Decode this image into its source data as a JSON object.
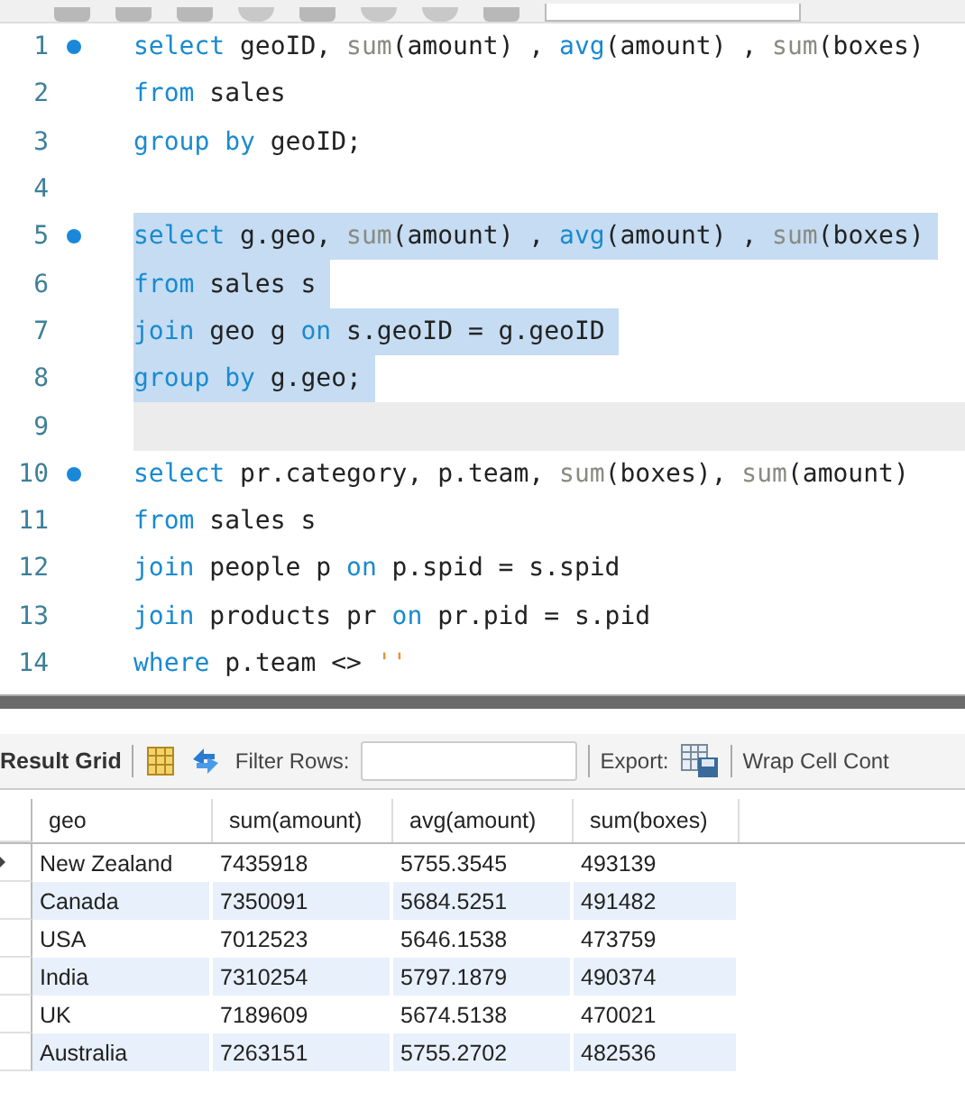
{
  "editor": {
    "lines": [
      {
        "number": "1",
        "statement_start": true,
        "selected": false,
        "current": false,
        "tokens": [
          {
            "kind": "keyword",
            "text": "select"
          },
          {
            "kind": "plain",
            "text": " geoID, "
          },
          {
            "kind": "function",
            "text": "sum"
          },
          {
            "kind": "plain",
            "text": "(amount) , "
          },
          {
            "kind": "keyword",
            "text": "avg"
          },
          {
            "kind": "plain",
            "text": "(amount) , "
          },
          {
            "kind": "function",
            "text": "sum"
          },
          {
            "kind": "plain",
            "text": "(boxes)"
          }
        ]
      },
      {
        "number": "2",
        "statement_start": false,
        "selected": false,
        "current": false,
        "tokens": [
          {
            "kind": "keyword",
            "text": "from"
          },
          {
            "kind": "plain",
            "text": " sales"
          }
        ]
      },
      {
        "number": "3",
        "statement_start": false,
        "selected": false,
        "current": false,
        "tokens": [
          {
            "kind": "keyword",
            "text": "group by"
          },
          {
            "kind": "plain",
            "text": " geoID;"
          }
        ]
      },
      {
        "number": "4",
        "statement_start": false,
        "selected": false,
        "current": false
      },
      {
        "number": "5",
        "statement_start": true,
        "selected": true,
        "current": false,
        "tokens": [
          {
            "kind": "keyword",
            "text": "select"
          },
          {
            "kind": "plain",
            "text": " g.geo, "
          },
          {
            "kind": "function",
            "text": "sum"
          },
          {
            "kind": "plain",
            "text": "(amount) , "
          },
          {
            "kind": "keyword",
            "text": "avg"
          },
          {
            "kind": "plain",
            "text": "(amount) , "
          },
          {
            "kind": "function",
            "text": "sum"
          },
          {
            "kind": "plain",
            "text": "(boxes)"
          }
        ]
      },
      {
        "number": "6",
        "statement_start": false,
        "selected": true,
        "current": false,
        "tokens": [
          {
            "kind": "keyword",
            "text": "from"
          },
          {
            "kind": "plain",
            "text": " sales s"
          }
        ]
      },
      {
        "number": "7",
        "statement_start": false,
        "selected": true,
        "current": false,
        "tokens": [
          {
            "kind": "keyword",
            "text": "join"
          },
          {
            "kind": "plain",
            "text": " geo g "
          },
          {
            "kind": "keyword",
            "text": "on"
          },
          {
            "kind": "plain",
            "text": " s.geoID = g.geoID"
          }
        ]
      },
      {
        "number": "8",
        "statement_start": false,
        "selected": true,
        "current": false,
        "tokens": [
          {
            "kind": "keyword",
            "text": "group by"
          },
          {
            "kind": "plain",
            "text": " g.geo;"
          }
        ]
      },
      {
        "number": "9",
        "statement_start": false,
        "selected": false,
        "current": true
      },
      {
        "number": "10",
        "statement_start": true,
        "selected": false,
        "current": false,
        "tokens": [
          {
            "kind": "keyword",
            "text": "select"
          },
          {
            "kind": "plain",
            "text": " pr.category, p.team, "
          },
          {
            "kind": "function",
            "text": "sum"
          },
          {
            "kind": "plain",
            "text": "(boxes), "
          },
          {
            "kind": "function",
            "text": "sum"
          },
          {
            "kind": "plain",
            "text": "(amount)"
          }
        ]
      },
      {
        "number": "11",
        "statement_start": false,
        "selected": false,
        "current": false,
        "tokens": [
          {
            "kind": "keyword",
            "text": "from"
          },
          {
            "kind": "plain",
            "text": " sales s"
          }
        ]
      },
      {
        "number": "12",
        "statement_start": false,
        "selected": false,
        "current": false,
        "tokens": [
          {
            "kind": "keyword",
            "text": "join"
          },
          {
            "kind": "plain",
            "text": " people p "
          },
          {
            "kind": "keyword",
            "text": "on"
          },
          {
            "kind": "plain",
            "text": " p.spid = s.spid"
          }
        ]
      },
      {
        "number": "13",
        "statement_start": false,
        "selected": false,
        "current": false,
        "tokens": [
          {
            "kind": "keyword",
            "text": "join"
          },
          {
            "kind": "plain",
            "text": " products pr "
          },
          {
            "kind": "keyword",
            "text": "on"
          },
          {
            "kind": "plain",
            "text": " pr.pid = s.pid"
          }
        ]
      },
      {
        "number": "14",
        "statement_start": false,
        "selected": false,
        "current": false,
        "tokens": [
          {
            "kind": "keyword",
            "text": "where"
          },
          {
            "kind": "plain",
            "text": " p.team <> "
          },
          {
            "kind": "string",
            "text": "''"
          }
        ]
      }
    ]
  },
  "result_toolbar": {
    "title": "Result Grid",
    "filter_label": "Filter Rows:",
    "export_label": "Export:",
    "wrap_label": "Wrap Cell Cont"
  },
  "table": {
    "columns": [
      "geo",
      "sum(amount)",
      "avg(amount)",
      "sum(boxes)"
    ],
    "rows": [
      {
        "current": true,
        "cells": [
          "New Zealand",
          "7435918",
          "5755.3545",
          "493139"
        ]
      },
      {
        "current": false,
        "cells": [
          "Canada",
          "7350091",
          "5684.5251",
          "491482"
        ]
      },
      {
        "current": false,
        "cells": [
          "USA",
          "7012523",
          "5646.1538",
          "473759"
        ]
      },
      {
        "current": false,
        "cells": [
          "India",
          "7310254",
          "5797.1879",
          "490374"
        ]
      },
      {
        "current": false,
        "cells": [
          "UK",
          "7189609",
          "5674.5138",
          "470021"
        ]
      },
      {
        "current": false,
        "cells": [
          "Australia",
          "7263151",
          "5755.2702",
          "482536"
        ]
      }
    ]
  }
}
